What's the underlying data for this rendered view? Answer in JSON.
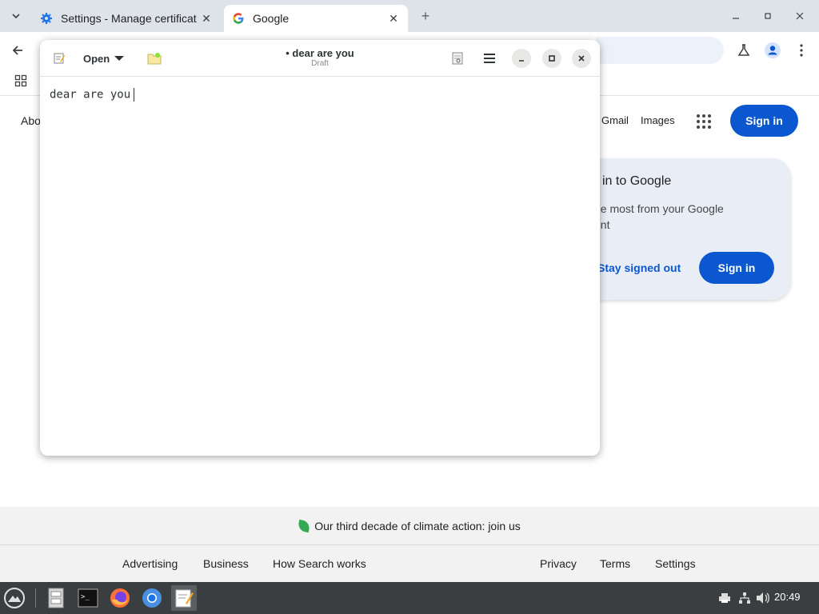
{
  "browser": {
    "tabs": [
      {
        "title": "Settings - Manage certificat",
        "icon": "gear-icon",
        "active": false
      },
      {
        "title": "Google",
        "icon": "google-g-icon",
        "active": true
      }
    ],
    "colors": {
      "tabstrip": "#dee3ea",
      "accent": "#0b57d0"
    }
  },
  "google": {
    "about": "Abo",
    "gmail": "Gmail",
    "images": "Images",
    "signin_top": "Sign in",
    "popup": {
      "title": "in to Google",
      "sub_line1": "he most from your Google",
      "sub_line2": "unt",
      "stay_signed_out": "Stay signed out",
      "signin": "Sign in"
    },
    "footer": {
      "climate": "Our third decade of climate action: join us",
      "advertising": "Advertising",
      "business": "Business",
      "how_search_works": "How Search works",
      "privacy": "Privacy",
      "terms": "Terms",
      "settings": "Settings"
    }
  },
  "gedit": {
    "open_label": "Open",
    "title": "• dear are you",
    "subtitle": "Draft",
    "content": "dear are you"
  },
  "taskbar": {
    "apps": [
      "file-manager-icon",
      "terminal-icon",
      "firefox-icon",
      "chromium-icon",
      "text-editor-icon"
    ],
    "clock": "20:49"
  }
}
